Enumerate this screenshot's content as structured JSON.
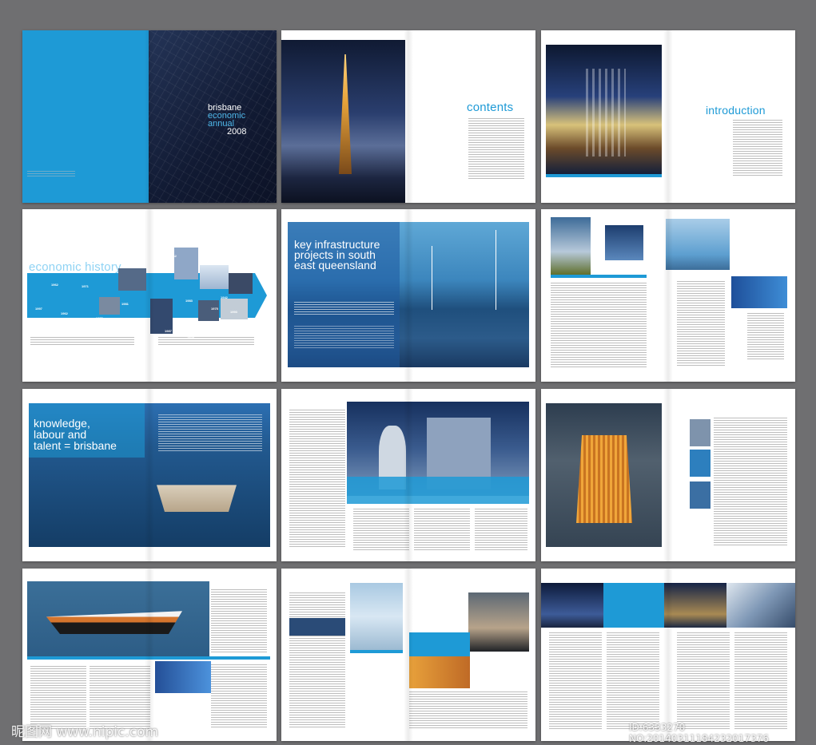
{
  "cover": {
    "title_line1": "brisbane",
    "title_line2": "economic",
    "title_line3": "annual",
    "year": "2008"
  },
  "contents": {
    "title": "contents"
  },
  "introduction": {
    "title": "introduction"
  },
  "economic_history": {
    "title": "economic history",
    "years": [
      "1862",
      "1911",
      "1928",
      "1962",
      "1971",
      "1981",
      "1942",
      "1997",
      "1962",
      "1978",
      "1983",
      "1987",
      "1993",
      "1928",
      "1984",
      "1970",
      "1942",
      "1975"
    ]
  },
  "key_infrastructure": {
    "title_line1": "key infrastructure",
    "title_line2": "projects in south",
    "title_line3": "east queensland"
  },
  "knowledge": {
    "title_line1": "knowledge,",
    "title_line2": "labour and",
    "title_line3": "talent = brisbane"
  },
  "watermark_left": "昵图网 www.nipic.com",
  "watermark_right": "ID:6333270 NO:20140311184232017376",
  "colors": {
    "accent": "#1e9ad6",
    "background": "#6f6f71",
    "navy": "#1a2b4a"
  }
}
